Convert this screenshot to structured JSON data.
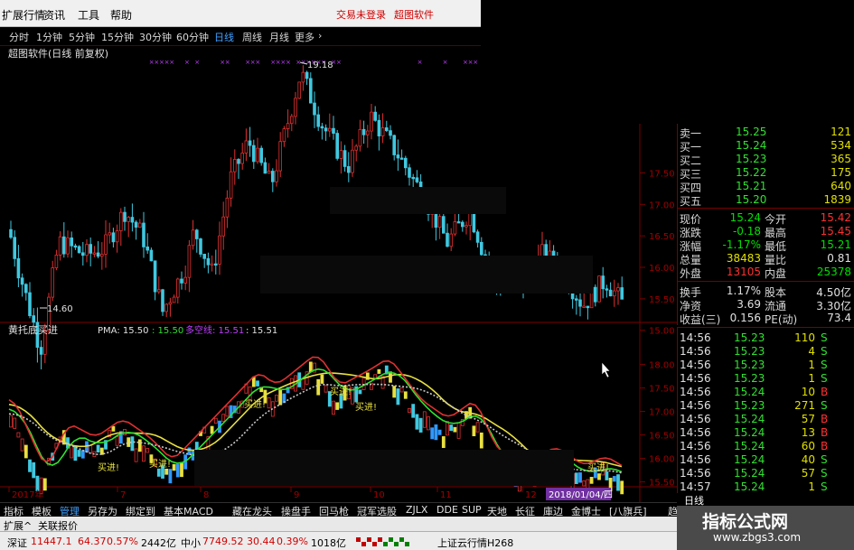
{
  "menubar": {
    "items": [
      "扩展行情",
      "资讯",
      "工具",
      "帮助"
    ],
    "warning_login": "交易未登录",
    "software_name": "超图软件"
  },
  "timeframes": [
    "分时",
    "1分钟",
    "5分钟",
    "15分钟",
    "30分钟",
    "60分钟",
    "日线",
    "周线",
    "月线",
    "更多"
  ],
  "timeframe_active": "日线",
  "main_chart": {
    "title": "超图软件(日线 前复权)",
    "high_label": "19.18",
    "low_label": "14.60",
    "price_ticks": [
      "17.50",
      "17.00",
      "16.50",
      "16.00",
      "15.50",
      "15.00"
    ]
  },
  "indicator": {
    "name": "黄托底买进",
    "pma_label": "PMA: 15.50",
    "pma2_label": ": 15.50",
    "multi_label": "多空线: 15.51",
    "extra_label": ": 15.51",
    "buy_label": "买进!",
    "ticks": [
      "18.00",
      "17.50",
      "17.00",
      "16.50",
      "16.00",
      "15.50",
      "15.00"
    ]
  },
  "date_axis": {
    "labels": [
      "2017年",
      "7",
      "8",
      "9",
      "10",
      "11",
      "12"
    ],
    "current_date": "2018/01/04/四",
    "period": "日线"
  },
  "quote_panel": {
    "asks": [
      {
        "label": "卖一",
        "price": "15.25",
        "vol": "121"
      },
      {
        "label": "买一",
        "price": "15.24",
        "vol": "534"
      },
      {
        "label": "买二",
        "price": "15.23",
        "vol": "365"
      },
      {
        "label": "买三",
        "price": "15.22",
        "vol": "175"
      },
      {
        "label": "买四",
        "price": "15.21",
        "vol": "640"
      },
      {
        "label": "买五",
        "price": "15.20",
        "vol": "1839"
      }
    ],
    "stats": [
      {
        "l1": "现价",
        "v1": "15.24",
        "l2": "今开",
        "v2": "15.42",
        "c1": "#00e000",
        "c2": "#ff3030"
      },
      {
        "l1": "涨跌",
        "v1": "-0.18",
        "l2": "最高",
        "v2": "15.45",
        "c1": "#00e000",
        "c2": "#ff3030"
      },
      {
        "l1": "涨幅",
        "v1": "-1.17%",
        "l2": "最低",
        "v2": "15.21",
        "c1": "#00e000",
        "c2": "#00e000"
      },
      {
        "l1": "总量",
        "v1": "38483",
        "l2": "量比",
        "v2": "0.81",
        "c1": "#e0e000",
        "c2": "#e0e0e0"
      },
      {
        "l1": "外盘",
        "v1": "13105",
        "l2": "内盘",
        "v2": "25378",
        "c1": "#ff3030",
        "c2": "#00e000"
      }
    ],
    "stats2": [
      {
        "l1": "换手",
        "v1": "1.17%",
        "l2": "股本",
        "v2": "4.50亿"
      },
      {
        "l1": "净资",
        "v1": "3.69",
        "l2": "流通",
        "v2": "3.30亿"
      },
      {
        "l1": "收益(三)",
        "v1": "0.156",
        "l2": "PE(动)",
        "v2": "73.4"
      }
    ]
  },
  "tick_list": [
    {
      "time": "14:56",
      "price": "15.23",
      "vol": "110",
      "side": "S"
    },
    {
      "time": "14:56",
      "price": "15.23",
      "vol": "4",
      "side": "S"
    },
    {
      "time": "14:56",
      "price": "15.23",
      "vol": "1",
      "side": "S"
    },
    {
      "time": "14:56",
      "price": "15.23",
      "vol": "1",
      "side": "S"
    },
    {
      "time": "14:56",
      "price": "15.24",
      "vol": "10",
      "side": "B"
    },
    {
      "time": "14:56",
      "price": "15.23",
      "vol": "271",
      "side": "S"
    },
    {
      "time": "14:56",
      "price": "15.24",
      "vol": "57",
      "side": "B"
    },
    {
      "time": "14:56",
      "price": "15.24",
      "vol": "13",
      "side": "B"
    },
    {
      "time": "14:56",
      "price": "15.24",
      "vol": "60",
      "side": "B"
    },
    {
      "time": "14:56",
      "price": "15.24",
      "vol": "40",
      "side": "S"
    },
    {
      "time": "14:56",
      "price": "15.24",
      "vol": "57",
      "side": "S"
    },
    {
      "time": "14:57",
      "price": "15.24",
      "vol": "1",
      "side": "S"
    }
  ],
  "bottom_tabs": [
    "指标",
    "模板",
    "管理",
    "另存为",
    "绑定到",
    "基本MACD",
    "藏在龙头",
    "操盘手",
    "回马枪",
    "冠军选股",
    "ZJLX",
    "DDE",
    "SUP",
    "天地",
    "长征",
    "庫边",
    "金博士",
    "[八旗兵]",
    "趋势彩带"
  ],
  "bottom_tab_active": "管理",
  "expand_tabs": [
    "扩展^",
    "关联报价"
  ],
  "status": {
    "sh_label": "深证",
    "sh_index": "11447.1",
    "sh_change": "64.37",
    "sh_pct": "0.57%",
    "sh_amount": "2442亿",
    "sme_label": "中小",
    "sme_index": "7749.52",
    "sme_change": "30.44",
    "sme_pct": "0.39%",
    "sme_amount": "1018亿",
    "server": "上证云行情H268"
  },
  "watermark": {
    "line1": "指标公式网",
    "line2": "www.zbgs3.com"
  },
  "colors": {
    "up": "#e03030",
    "down": "#40c8e0",
    "yellow": "#e8e040",
    "green": "#30e030",
    "grid": "#7a0000",
    "magenta": "#c040ff",
    "blue_bar": "#3098ff"
  }
}
